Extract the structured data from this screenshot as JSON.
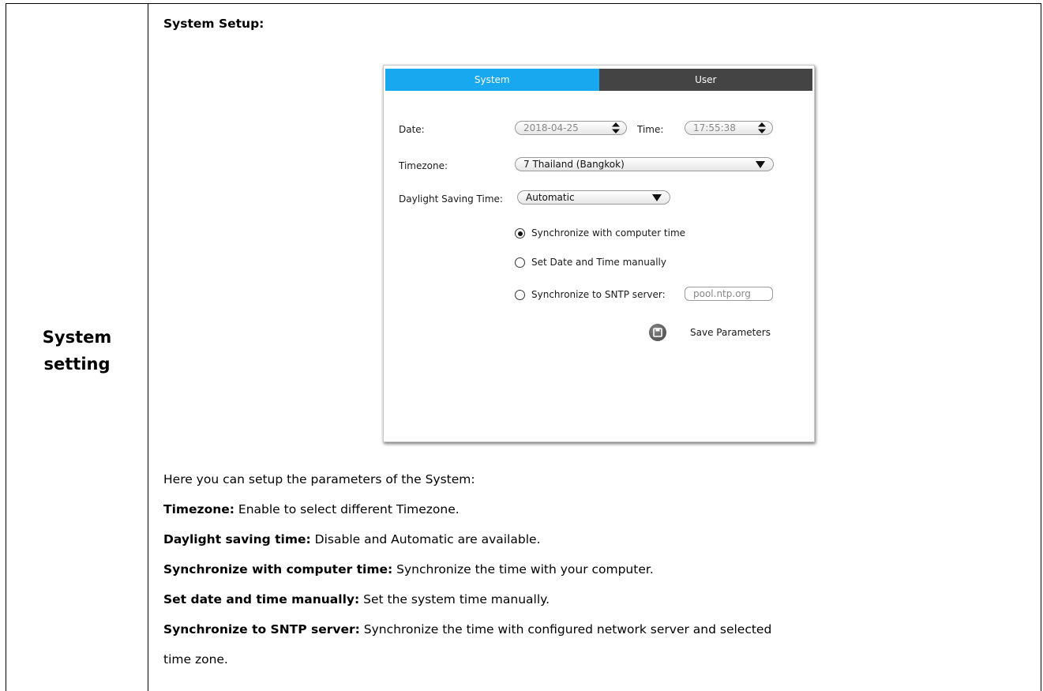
{
  "row_label": {
    "line1": "System",
    "line2": "setting"
  },
  "section_title": "System Setup:",
  "ui": {
    "tabs": {
      "system": "System",
      "user": "User"
    },
    "date_label": "Date:",
    "date_value": "2018-04-25",
    "time_label": "Time:",
    "time_value": "17:55:38",
    "timezone_label": "Timezone:",
    "timezone_value": "7 Thailand (Bangkok)",
    "dst_label": "Daylight Saving Time:",
    "dst_value": "Automatic",
    "radio_sync_computer": "Synchronize with computer time",
    "radio_manual": "Set Date and Time manually",
    "radio_sntp": "Synchronize to SNTP server:",
    "sntp_value": "pool.ntp.org",
    "save_label": "Save Parameters",
    "selected_option": "Synchronize with computer time",
    "colors": {
      "tab_active": "#18a8f0",
      "tab_inactive": "#444444"
    }
  },
  "description": {
    "intro": "Here you can setup the parameters of the System:",
    "items": [
      {
        "term": "Timezone:",
        "text": " Enable to select different Timezone."
      },
      {
        "term": "Daylight saving time:",
        "text": " Disable and Automatic are available."
      },
      {
        "term": "Synchronize with computer time:",
        "text": " Synchronize the time with your computer."
      },
      {
        "term": "Set date and time manually:",
        "text": " Set the system time manually."
      },
      {
        "term": "Synchronize to SNTP server:",
        "text": " Synchronize the time with configured network server and selected"
      }
    ],
    "continuation": "time zone."
  }
}
